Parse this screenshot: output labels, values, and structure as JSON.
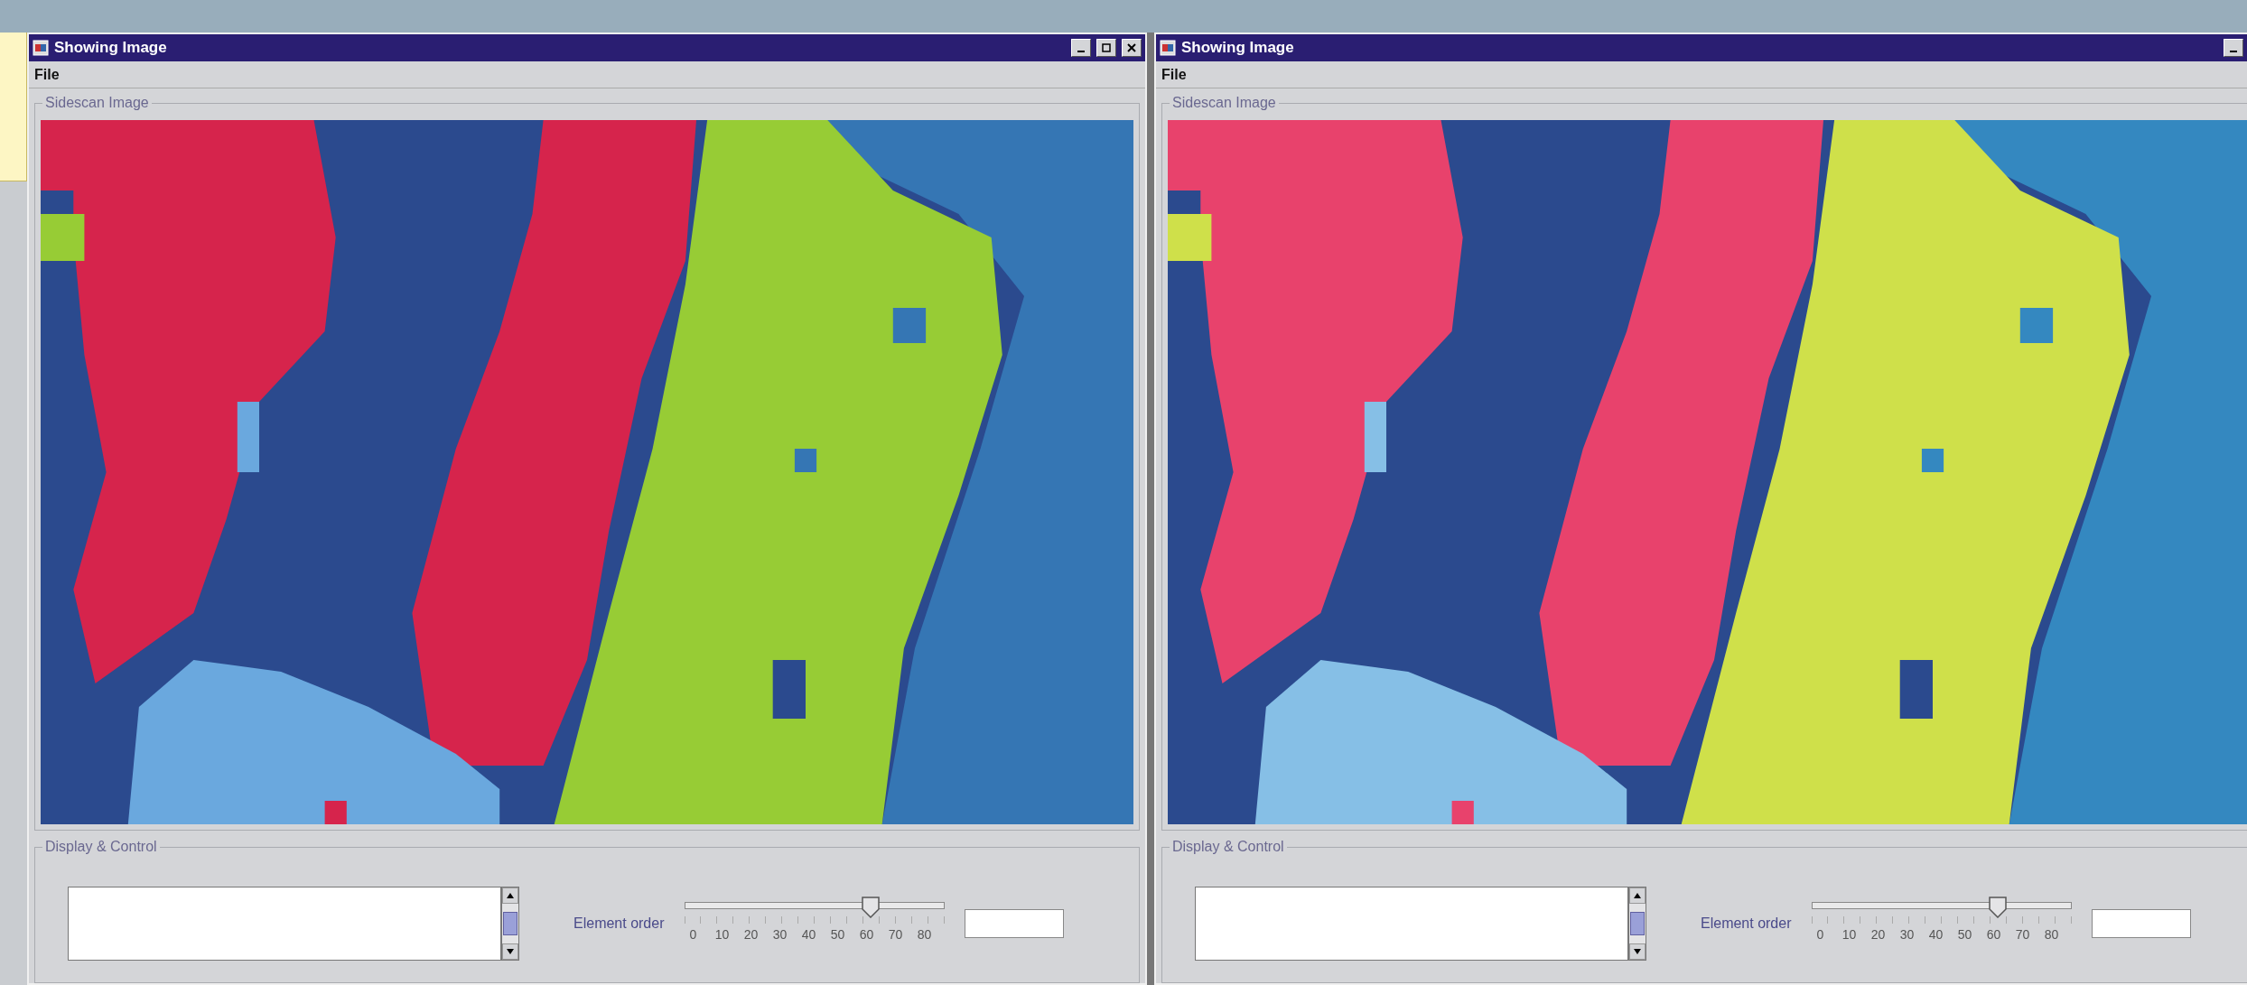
{
  "windows": [
    {
      "title": "Showing Image",
      "menu": [
        "File"
      ],
      "image_panel": {
        "title": "Sidescan Image"
      },
      "control_panel": {
        "title": "Display & Control",
        "slider": {
          "label": "Element order",
          "level": 0.72,
          "ticks": [
            "0",
            "10",
            "20",
            "30",
            "40",
            "50",
            "60",
            "70",
            "80"
          ]
        }
      }
    },
    {
      "title": "Showing Image",
      "menu": [
        "File"
      ],
      "image_panel": {
        "title": "Sidescan Image"
      },
      "control_panel": {
        "title": "Display & Control",
        "slider": {
          "label": "Element order",
          "level": 0.72,
          "ticks": [
            "0",
            "10",
            "20",
            "30",
            "40",
            "50",
            "60",
            "70",
            "80"
          ]
        }
      }
    }
  ]
}
